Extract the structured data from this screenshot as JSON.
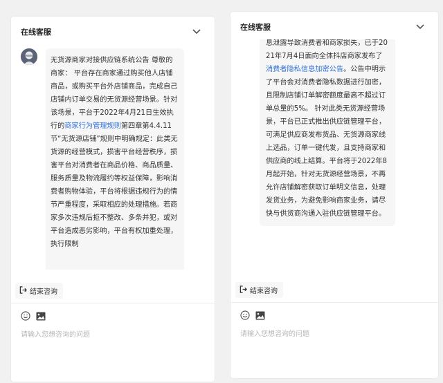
{
  "panels": {
    "left": {
      "title": "在线客服",
      "message_before_link1": "无货源商家对接供应链系统公告 尊敬的商家： 平台存在商家通过购买他人店铺商品，或购买平台外店铺商品，完成自己店铺内订单交易的无货源经营场景。针对该场景，平台于2022年4月21日生效执行的",
      "link1": "商家行为管理规则",
      "message_after_link1": "第四章第4.4.11节“无货源店铺”规则中明确规定：此类无货源的经营模式，损害平台经营秩序，损害平台对消费者在商品价格、商品质量、服务质量及物流履约等权益保障，影响消费者购物体验，平台将根据违规行为的情节严重程度，采取相应的处理措施。若商家多次违规后拒不整改、多条并犯，或对平台造成恶劣影响，平台有权加重处理，执行限制",
      "end_button": "结束咨询",
      "input_placeholder": "请输入您想咨询的问题"
    },
    "right": {
      "title": "在线客服",
      "message_before_link": "息泄露导致消费者和商家损失，已于2021年7月4日面向全体抖店商家发布了",
      "link": "消费者隐私信息加密公告",
      "message_after_link": "。公告中明示了平台会对消费者隐私数据进行加密，且限制店铺订单解密额度最高不超过订单总量的5%。 针对此类无货源经营场景，平台已正式推出供应链管理平台，可满足供应商发布货品、无货源商家线上选品，订单一键代发，且支持商家和供应商的线上结算。平台将于2022年8月起开始，针对无货源经营场景，不再允许店铺解密获取订单明文信息，处理发货业务，为避免影响商家业务，请尽快与供货商沟通入驻供应链管理平台。",
      "end_button": "结束咨询",
      "input_placeholder": "请输入您想咨询的问题"
    }
  },
  "icons": {
    "collapse": "chevron-down-icon",
    "end": "exit-icon",
    "emoji": "emoji-icon",
    "image": "image-icon",
    "avatar": "agent-avatar-icon"
  },
  "colors": {
    "link": "#2f6fd6",
    "bubble_bg": "#f6f6f6",
    "placeholder": "#b8b8b8"
  }
}
